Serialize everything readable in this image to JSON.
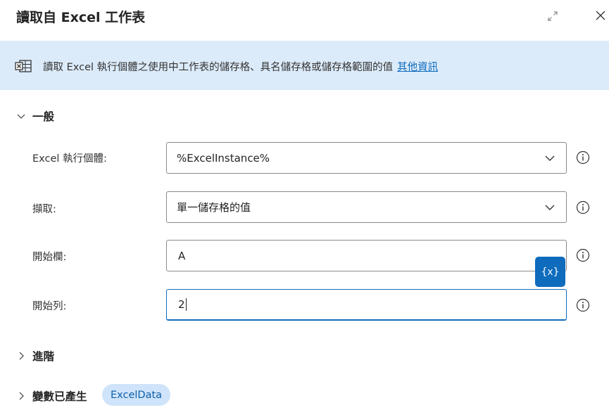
{
  "dialog": {
    "title": "讀取自 Excel 工作表",
    "icons": {
      "expand": "expand-icon",
      "close": "close-icon"
    }
  },
  "banner": {
    "icon": "excel-icon",
    "message": "讀取 Excel 執行個體之使用中工作表的儲存格、具名儲存格或儲存格範圍的值",
    "link": "其他資訊"
  },
  "general": {
    "header": "一般",
    "excel_instance": {
      "label": "Excel 執行個體:",
      "value": "%ExcelInstance%"
    },
    "retrieve": {
      "label": "擷取:",
      "value": "單一儲存格的值"
    },
    "start_column": {
      "label": "開始欄:",
      "value": "A"
    },
    "start_row": {
      "label": "開始列:",
      "value": "2"
    }
  },
  "variable_button": {
    "label": "{x}"
  },
  "advanced": {
    "header": "進階"
  },
  "variables": {
    "header": "變數已產生",
    "badge": "ExcelData"
  },
  "colors": {
    "accent": "#0f6cbd",
    "banner_bg": "#dcebfa",
    "badge_bg": "#cfe4fa"
  }
}
